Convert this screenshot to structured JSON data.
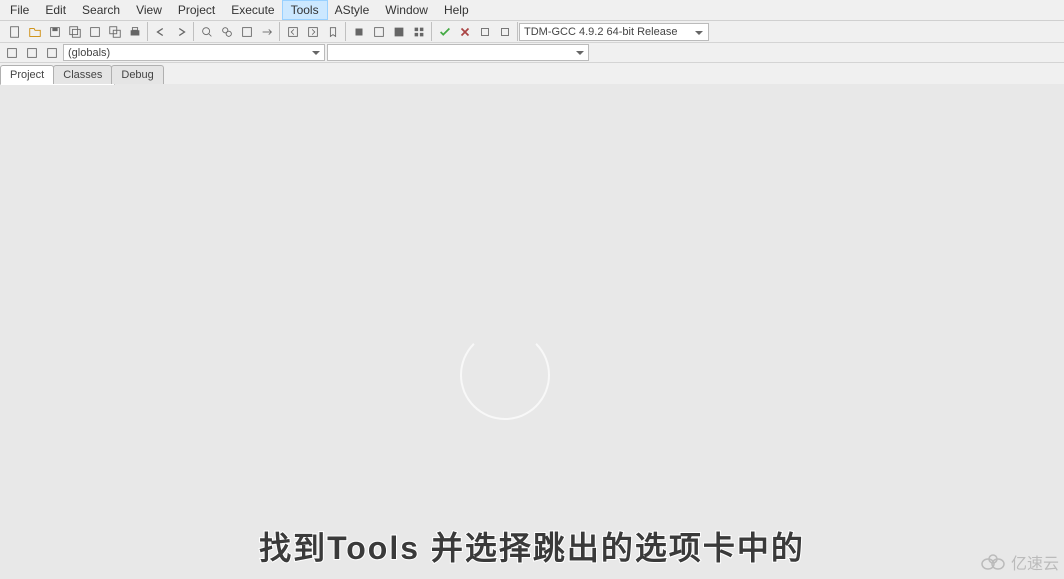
{
  "menubar": {
    "items": [
      "File",
      "Edit",
      "Search",
      "View",
      "Project",
      "Execute",
      "Tools",
      "AStyle",
      "Window",
      "Help"
    ],
    "highlighted": "Tools"
  },
  "toolbar": {
    "compiler_select": "TDM-GCC 4.9.2 64-bit Release"
  },
  "secondary": {
    "scope_select": "(globals)",
    "member_select": ""
  },
  "tabs": {
    "items": [
      "Project",
      "Classes",
      "Debug"
    ],
    "active": "Project"
  },
  "subtitle": "找到Tools 并选择跳出的选项卡中的",
  "watermark": "亿速云"
}
